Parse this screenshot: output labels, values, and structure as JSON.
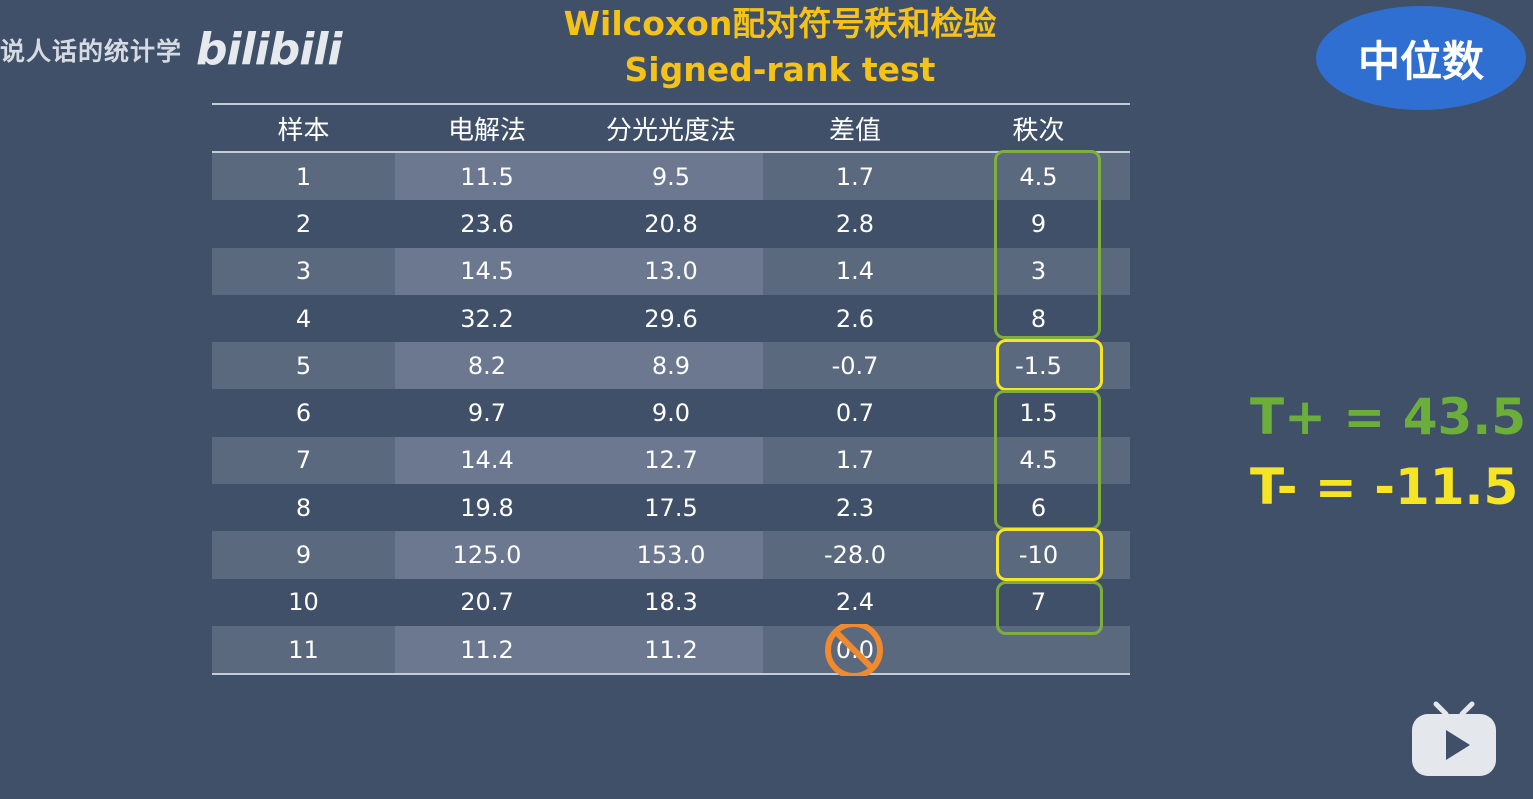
{
  "watermark": {
    "text": "说人话的统计学",
    "logo": "bilibili"
  },
  "title": {
    "line1": "Wilcoxon配对符号秩和检验",
    "line2": "Signed-rank test"
  },
  "badge": "中位数",
  "table": {
    "headers": [
      "样本",
      "电解法",
      "分光光度法",
      "差值",
      "秩次"
    ],
    "rows": [
      [
        "1",
        "11.5",
        "9.5",
        "1.7",
        "4.5"
      ],
      [
        "2",
        "23.6",
        "20.8",
        "2.8",
        "9"
      ],
      [
        "3",
        "14.5",
        "13.0",
        "1.4",
        "3"
      ],
      [
        "4",
        "32.2",
        "29.6",
        "2.6",
        "8"
      ],
      [
        "5",
        "8.2",
        "8.9",
        "-0.7",
        "-1.5"
      ],
      [
        "6",
        "9.7",
        "9.0",
        "0.7",
        "1.5"
      ],
      [
        "7",
        "14.4",
        "12.7",
        "1.7",
        "4.5"
      ],
      [
        "8",
        "19.8",
        "17.5",
        "2.3",
        "6"
      ],
      [
        "9",
        "125.0",
        "153.0",
        "-28.0",
        "-10"
      ],
      [
        "10",
        "20.7",
        "18.3",
        "2.4",
        "7"
      ],
      [
        "11",
        "11.2",
        "11.2",
        "0.0",
        ""
      ]
    ]
  },
  "totals": {
    "t_plus": "T+ = 43.5",
    "t_minus": "T- = -11.5"
  },
  "colors": {
    "background": "#3f5068",
    "title": "#f5c218",
    "positive": "#7fae3c",
    "negative": "#f5e524",
    "badge": "#2f6fd1",
    "excluded": "#f08a2c"
  },
  "icons": {
    "excluded": "no-sign-icon",
    "player": "bilibili-tv-icon"
  }
}
